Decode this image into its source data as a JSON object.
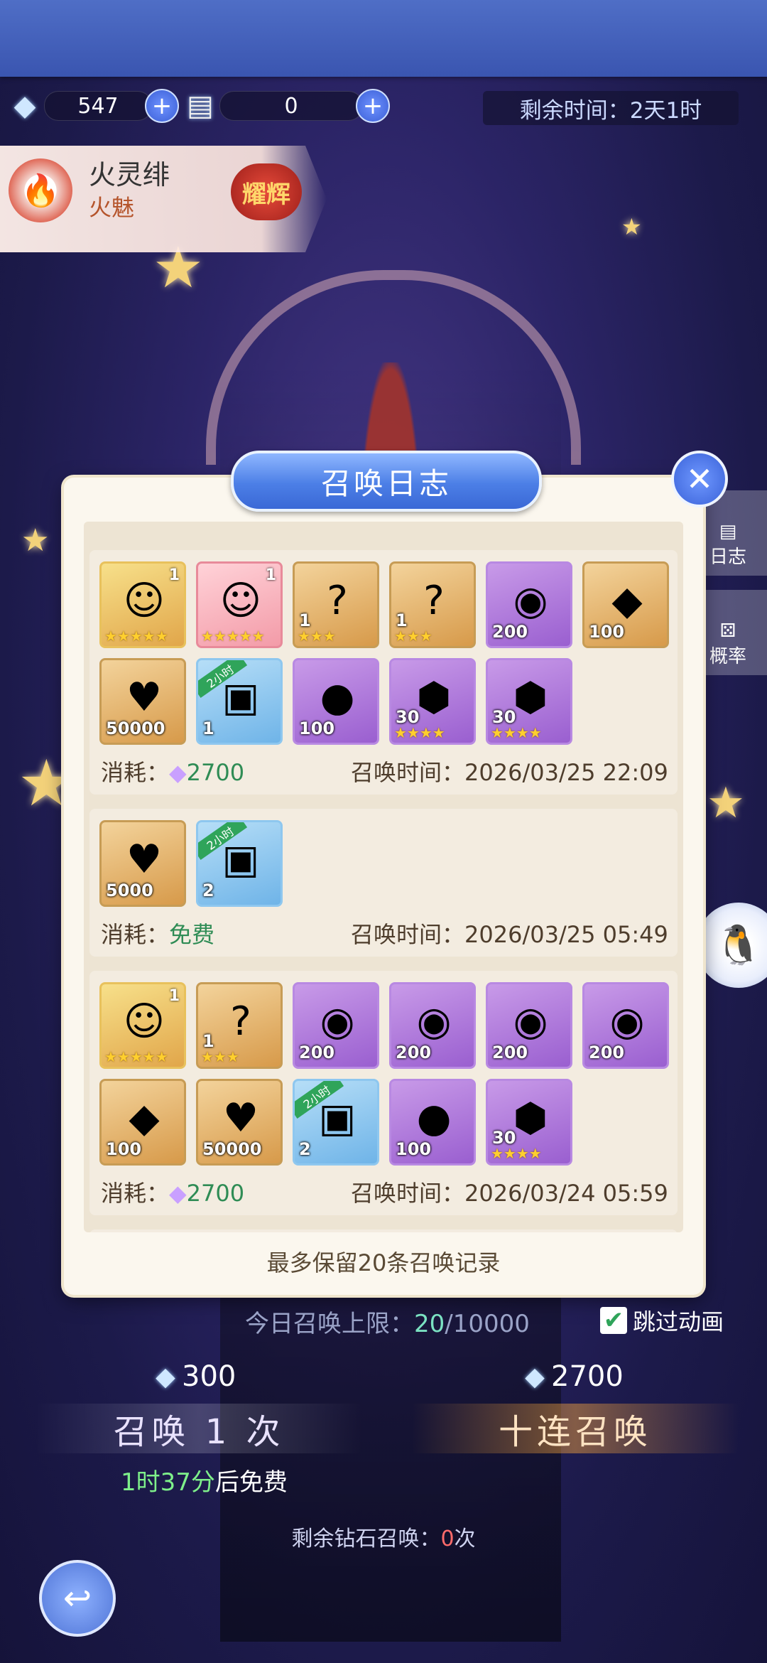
{
  "resources": {
    "diamond_count": "547",
    "ticket_count": "0",
    "icons": {
      "diamond": "diamond-icon",
      "ticket": "ticket-icon",
      "plus": "plus-icon"
    }
  },
  "timer": {
    "label": "剩余时间：",
    "value": "2天1时"
  },
  "hero": {
    "name": "火灵绯",
    "title": "火魅",
    "rank": "耀辉"
  },
  "side": {
    "log": "日志",
    "rate": "概率"
  },
  "dialog": {
    "title": "召唤日志",
    "footnote": "最多保留20条召唤记录",
    "records": [
      {
        "items": [
          {
            "kind": "hero-gold",
            "icon": "red-hair-hero-icon",
            "glyph": "☺",
            "level": "1",
            "stars": "★★★★★"
          },
          {
            "kind": "hero-pink",
            "icon": "white-hair-hero-icon",
            "glyph": "☺",
            "level": "1",
            "stars": "★★★★★"
          },
          {
            "kind": "orange",
            "icon": "mystery-box-icon",
            "glyph": "?",
            "qty": "1",
            "stars": "★★★"
          },
          {
            "kind": "orange",
            "icon": "mystery-box-icon",
            "glyph": "?",
            "qty": "1",
            "stars": "★★★"
          },
          {
            "kind": "purple",
            "icon": "crystal-ball-icon",
            "glyph": "◉",
            "qty": "200"
          },
          {
            "kind": "orange",
            "icon": "crystal-gem-icon",
            "glyph": "◆",
            "qty": "100"
          },
          {
            "kind": "orange",
            "icon": "exp-heart-icon",
            "glyph": "♥",
            "qty": "50000"
          },
          {
            "kind": "blue",
            "icon": "treasure-chest-icon",
            "glyph": "▣",
            "qty": "1",
            "badge": "2小时"
          },
          {
            "kind": "purple",
            "icon": "golden-egg-icon",
            "glyph": "●",
            "qty": "100"
          },
          {
            "kind": "purple",
            "icon": "purple-shard-icon",
            "glyph": "⬢",
            "qty": "30",
            "stars": "★★★★"
          },
          {
            "kind": "purple",
            "icon": "purple-shard-icon",
            "glyph": "⬢",
            "qty": "30",
            "stars": "★★★★"
          }
        ],
        "cost_label": "消耗：",
        "cost_value": "2700",
        "cost_free": false,
        "time_label": "召唤时间：",
        "time_value": "2026/03/25 22:09"
      },
      {
        "items": [
          {
            "kind": "orange",
            "icon": "exp-heart-icon",
            "glyph": "♥",
            "qty": "5000"
          },
          {
            "kind": "blue",
            "icon": "treasure-chest-icon",
            "glyph": "▣",
            "qty": "2",
            "badge": "2小时"
          }
        ],
        "cost_label": "消耗：",
        "cost_value": "免费",
        "cost_free": true,
        "time_label": "召唤时间：",
        "time_value": "2026/03/25 05:49"
      },
      {
        "items": [
          {
            "kind": "hero-gold",
            "icon": "red-hair-hero-icon",
            "glyph": "☺",
            "level": "1",
            "stars": "★★★★★"
          },
          {
            "kind": "orange",
            "icon": "mystery-box-icon",
            "glyph": "?",
            "qty": "1",
            "stars": "★★★"
          },
          {
            "kind": "purple",
            "icon": "crystal-ball-icon",
            "glyph": "◉",
            "qty": "200"
          },
          {
            "kind": "purple",
            "icon": "crystal-ball-icon",
            "glyph": "◉",
            "qty": "200"
          },
          {
            "kind": "purple",
            "icon": "crystal-ball-icon",
            "glyph": "◉",
            "qty": "200"
          },
          {
            "kind": "purple",
            "icon": "crystal-ball-icon",
            "glyph": "◉",
            "qty": "200"
          },
          {
            "kind": "orange",
            "icon": "crystal-gem-icon",
            "glyph": "◆",
            "qty": "100"
          },
          {
            "kind": "orange",
            "icon": "exp-heart-icon",
            "glyph": "♥",
            "qty": "50000"
          },
          {
            "kind": "blue",
            "icon": "treasure-chest-icon",
            "glyph": "▣",
            "qty": "2",
            "badge": "2小时"
          },
          {
            "kind": "purple",
            "icon": "golden-egg-icon",
            "glyph": "●",
            "qty": "100"
          },
          {
            "kind": "purple",
            "icon": "purple-shard-icon",
            "glyph": "⬢",
            "qty": "30",
            "stars": "★★★★"
          }
        ],
        "cost_label": "消耗：",
        "cost_value": "2700",
        "cost_free": false,
        "time_label": "召唤时间：",
        "time_value": "2026/03/24 05:59"
      }
    ]
  },
  "summon": {
    "limit_label": "今日召唤上限：",
    "limit_count": "20",
    "limit_total": "/10000",
    "skip_label": "跳过动画",
    "skip_checked": true,
    "single_cost": "300",
    "ten_cost": "2700",
    "single_label": "召唤 1 次",
    "ten_label": "十连召唤",
    "free_time": "1时37分",
    "free_suffix": "后免费",
    "remain_label": "剩余钻石召唤：",
    "remain_count": "0",
    "remain_unit": "次"
  },
  "colors": {
    "accent_blue": "#4c7fe6",
    "free_green": "#2f8c55",
    "gold": "#d79a4a",
    "purple": "#9a5fd0"
  }
}
